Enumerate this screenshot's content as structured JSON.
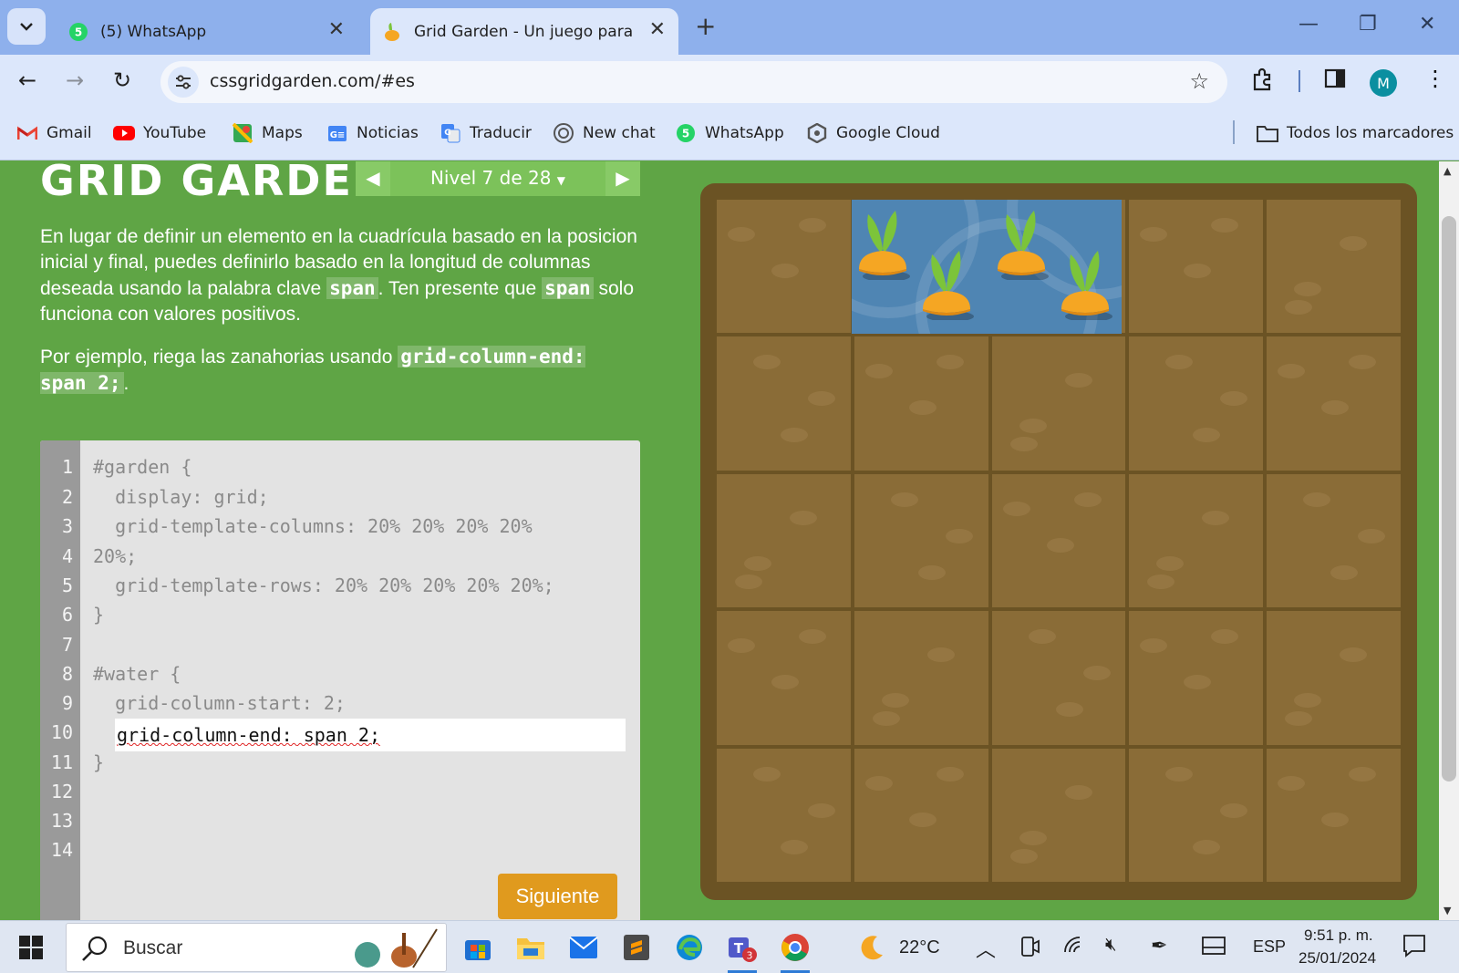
{
  "browser": {
    "tabs": [
      {
        "title": "(5) WhatsApp",
        "active": false,
        "badge": "5"
      },
      {
        "title": "Grid Garden - Un juego para ap",
        "active": true
      }
    ],
    "url": "cssgridgarden.com/#es",
    "profile_initial": "M",
    "bookmarks": [
      {
        "label": "Gmail",
        "icon": "gmail-icon"
      },
      {
        "label": "YouTube",
        "icon": "youtube-icon"
      },
      {
        "label": "Maps",
        "icon": "maps-icon"
      },
      {
        "label": "Noticias",
        "icon": "news-icon"
      },
      {
        "label": "Traducir",
        "icon": "translate-icon"
      },
      {
        "label": "New chat",
        "icon": "chatgpt-icon"
      },
      {
        "label": "WhatsApp",
        "icon": "whatsapp-icon"
      },
      {
        "label": "Google Cloud",
        "icon": "google-cloud-icon"
      },
      {
        "label": "Todos los marcadores",
        "icon": "folder-icon"
      }
    ]
  },
  "game": {
    "logo": "GRID GARDEN",
    "level_label": "Nivel 7 de 28",
    "description": {
      "p1_a": "En lugar de definir un elemento en la cuadrícula basado en la posicion inicial y final, puedes definirlo basado en la longitud de columnas deseada usando la palabra clave ",
      "p1_code1": "span",
      "p1_b": ". Ten presente que ",
      "p1_code2": "span",
      "p1_c": " solo funciona con valores positivos.",
      "p2_a": "Por ejemplo, riega las zanahorias usando ",
      "p2_code": "grid-column-end: span 2;",
      "p2_b": "."
    },
    "editor": {
      "line_numbers": [
        "1",
        "2",
        "3",
        "4",
        "5",
        "6",
        "7",
        "8",
        "9",
        "10",
        "11",
        "12",
        "13",
        "14"
      ],
      "lines": [
        "#garden {",
        "  display: grid;",
        "  grid-template-columns: 20% 20% 20% 20%",
        "20%;",
        "  grid-template-rows: 20% 20% 20% 20% 20%;",
        "}",
        "",
        "#water {",
        "  grid-column-start: 2;",
        "",
        "}"
      ],
      "input_value": "grid-column-end: span 2;"
    },
    "next_button": "Siguiente"
  },
  "taskbar": {
    "search_placeholder": "Buscar",
    "weather": "22°C",
    "language": "ESP",
    "time": "9:51 p. m.",
    "date": "25/01/2024",
    "teams_badge": "3"
  },
  "colors": {
    "page_green": "#5fa545",
    "soil": "#8a6c37",
    "water": "#4f85b3",
    "carrot": "#f5a623",
    "leaf": "#7cc43a"
  }
}
